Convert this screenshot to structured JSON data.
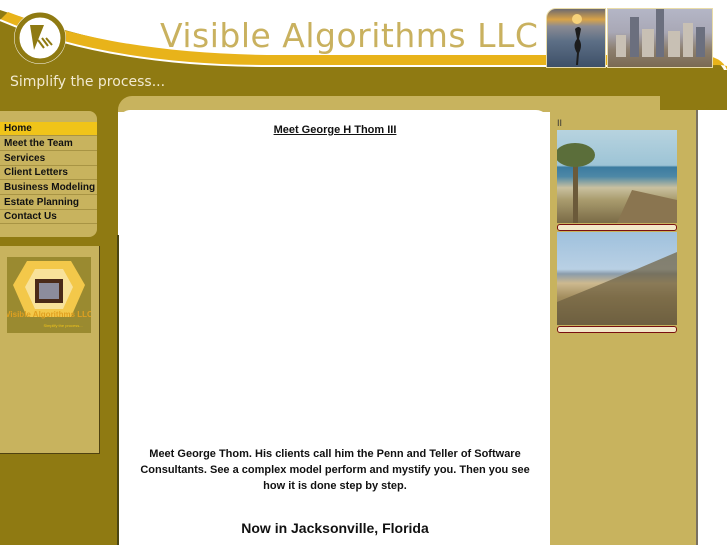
{
  "header": {
    "site_title": "Visible Algorithms LLC",
    "tagline": "Simplify the process...",
    "logo_icon": "va-circle-logo-icon",
    "photos": [
      "heron-sunset-photo",
      "city-skyline-photo"
    ]
  },
  "colors": {
    "olive": "#8f7a12",
    "gold": "#e8b31a",
    "tan": "#c8b35e",
    "active_nav": "#f0c419",
    "title_text": "#c9b15f"
  },
  "nav": {
    "items": [
      {
        "label": "Home",
        "active": true
      },
      {
        "label": "Meet the Team",
        "active": false
      },
      {
        "label": "Services",
        "active": false
      },
      {
        "label": "Client Letters",
        "active": false
      },
      {
        "label": "Business Modeling",
        "active": false
      },
      {
        "label": "Estate Planning",
        "active": false
      },
      {
        "label": "Contact Us",
        "active": false
      }
    ]
  },
  "sidebar_logo": {
    "text": "Visible Algorithms LLC",
    "subtext": "Simplify the process..."
  },
  "main": {
    "title": "Meet George H Thom III",
    "paragraph": "Meet George Thom. His clients call him the Penn and Teller of Software Consultants. See a complex model perform and mystify you. Then you see how it is done step by step.",
    "location": "Now in Jacksonville, Florida"
  },
  "right": {
    "marker": "II",
    "photos": [
      "beach-palm-photo",
      "beach-dunes-photo"
    ]
  }
}
